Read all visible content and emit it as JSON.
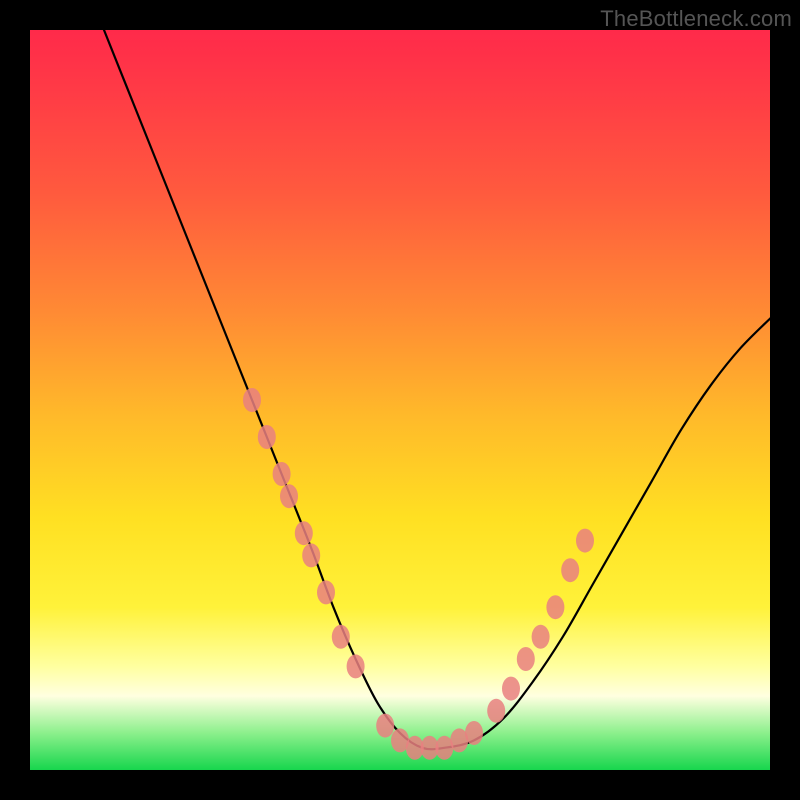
{
  "watermark": "TheBottleneck.com",
  "chart_data": {
    "type": "line",
    "title": "",
    "xlabel": "",
    "ylabel": "",
    "xlim": [
      0,
      100
    ],
    "ylim": [
      0,
      100
    ],
    "grid": false,
    "legend": false,
    "series": [
      {
        "name": "bottleneck-curve",
        "color": "#000000",
        "x": [
          10,
          14,
          18,
          22,
          26,
          30,
          34,
          38,
          41,
          44,
          47,
          50,
          53,
          56,
          60,
          64,
          68,
          72,
          76,
          80,
          84,
          88,
          92,
          96,
          100
        ],
        "y": [
          100,
          90,
          80,
          70,
          60,
          50,
          40,
          30,
          22,
          15,
          9,
          5,
          3,
          3,
          4,
          7,
          12,
          18,
          25,
          32,
          39,
          46,
          52,
          57,
          61
        ]
      }
    ],
    "markers": {
      "name": "highlighted-points",
      "color": "#e98080",
      "points": [
        {
          "x": 30,
          "y": 50
        },
        {
          "x": 32,
          "y": 45
        },
        {
          "x": 34,
          "y": 40
        },
        {
          "x": 35,
          "y": 37
        },
        {
          "x": 37,
          "y": 32
        },
        {
          "x": 38,
          "y": 29
        },
        {
          "x": 40,
          "y": 24
        },
        {
          "x": 42,
          "y": 18
        },
        {
          "x": 44,
          "y": 14
        },
        {
          "x": 48,
          "y": 6
        },
        {
          "x": 50,
          "y": 4
        },
        {
          "x": 52,
          "y": 3
        },
        {
          "x": 54,
          "y": 3
        },
        {
          "x": 56,
          "y": 3
        },
        {
          "x": 58,
          "y": 4
        },
        {
          "x": 60,
          "y": 5
        },
        {
          "x": 63,
          "y": 8
        },
        {
          "x": 65,
          "y": 11
        },
        {
          "x": 67,
          "y": 15
        },
        {
          "x": 69,
          "y": 18
        },
        {
          "x": 71,
          "y": 22
        },
        {
          "x": 73,
          "y": 27
        },
        {
          "x": 75,
          "y": 31
        }
      ]
    },
    "background_gradient_stops": [
      {
        "pos": 0.0,
        "color": "#ff2a4a"
      },
      {
        "pos": 0.5,
        "color": "#ffb92a"
      },
      {
        "pos": 0.8,
        "color": "#ffff80"
      },
      {
        "pos": 0.95,
        "color": "#8cf08c"
      },
      {
        "pos": 1.0,
        "color": "#17d64d"
      }
    ]
  }
}
